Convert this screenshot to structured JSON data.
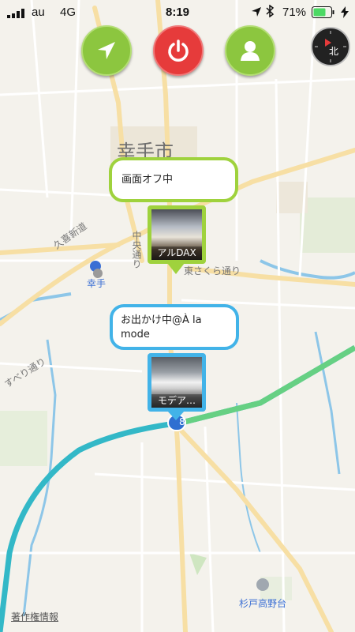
{
  "status": {
    "carrier": "au",
    "network": "4G",
    "time": "8:19",
    "battery": "71%"
  },
  "buttons": {
    "navigate": "navigate-arrow-icon",
    "power": "power-icon",
    "profile": "person-icon"
  },
  "compass": {
    "label": "北"
  },
  "map": {
    "city_label": "幸手市",
    "road_kuki": "久喜新道",
    "road_chuo": "中央通り",
    "road_higashi": "東さくら通り",
    "road_suberi": "すべり通り",
    "station_satte": "幸手",
    "station_sugito": "杉戸高野台",
    "route_shield": "8",
    "copyright": "著作権情報"
  },
  "users": [
    {
      "status": "画面オフ中",
      "name": "アルDAX",
      "border": "#9fd23d"
    },
    {
      "status": "お出かけ中@À la mode",
      "name": "モデア…",
      "border": "#42b3e8"
    }
  ],
  "colors": {
    "green": "#8cc63f",
    "red": "#e63b3b",
    "blue": "#42b3e8",
    "highway": "#33b8c7"
  }
}
